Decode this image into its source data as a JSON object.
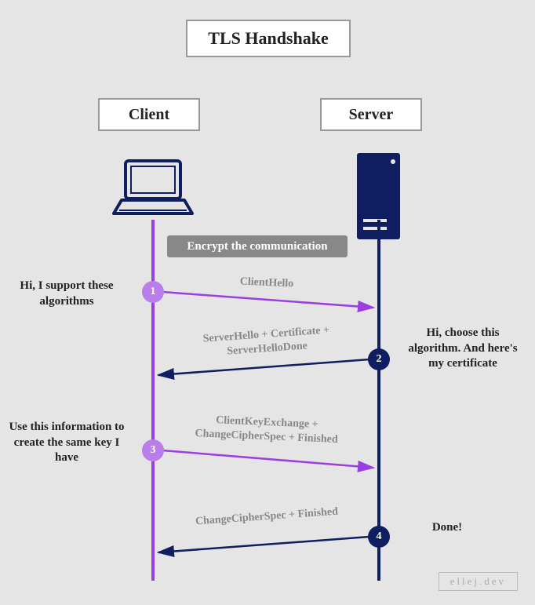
{
  "title": "TLS Handshake",
  "roles": {
    "client": "Client",
    "server": "Server"
  },
  "encrypt_pill": "Encrypt the communication",
  "steps": {
    "s1": "1",
    "s2": "2",
    "s3": "3",
    "s4": "4"
  },
  "notes": {
    "n1": "Hi, I support these algorithms",
    "n2": "Hi, choose this algorithm. And here's my certificate",
    "n3": "Use this information to create the same key I have",
    "n4": "Done!"
  },
  "messages": {
    "m1": "ClientHello",
    "m2": "ServerHello + Certificate + ServerHelloDone",
    "m3": "ClientKeyExchange + ChangeCipherSpec + Finished",
    "m4": "ChangeCipherSpec + Finished"
  },
  "colors": {
    "purple": "#9b3fe0",
    "purple_light": "#b97eea",
    "navy": "#0f1e60",
    "grey_text": "#888"
  },
  "credit": "ellej.dev"
}
